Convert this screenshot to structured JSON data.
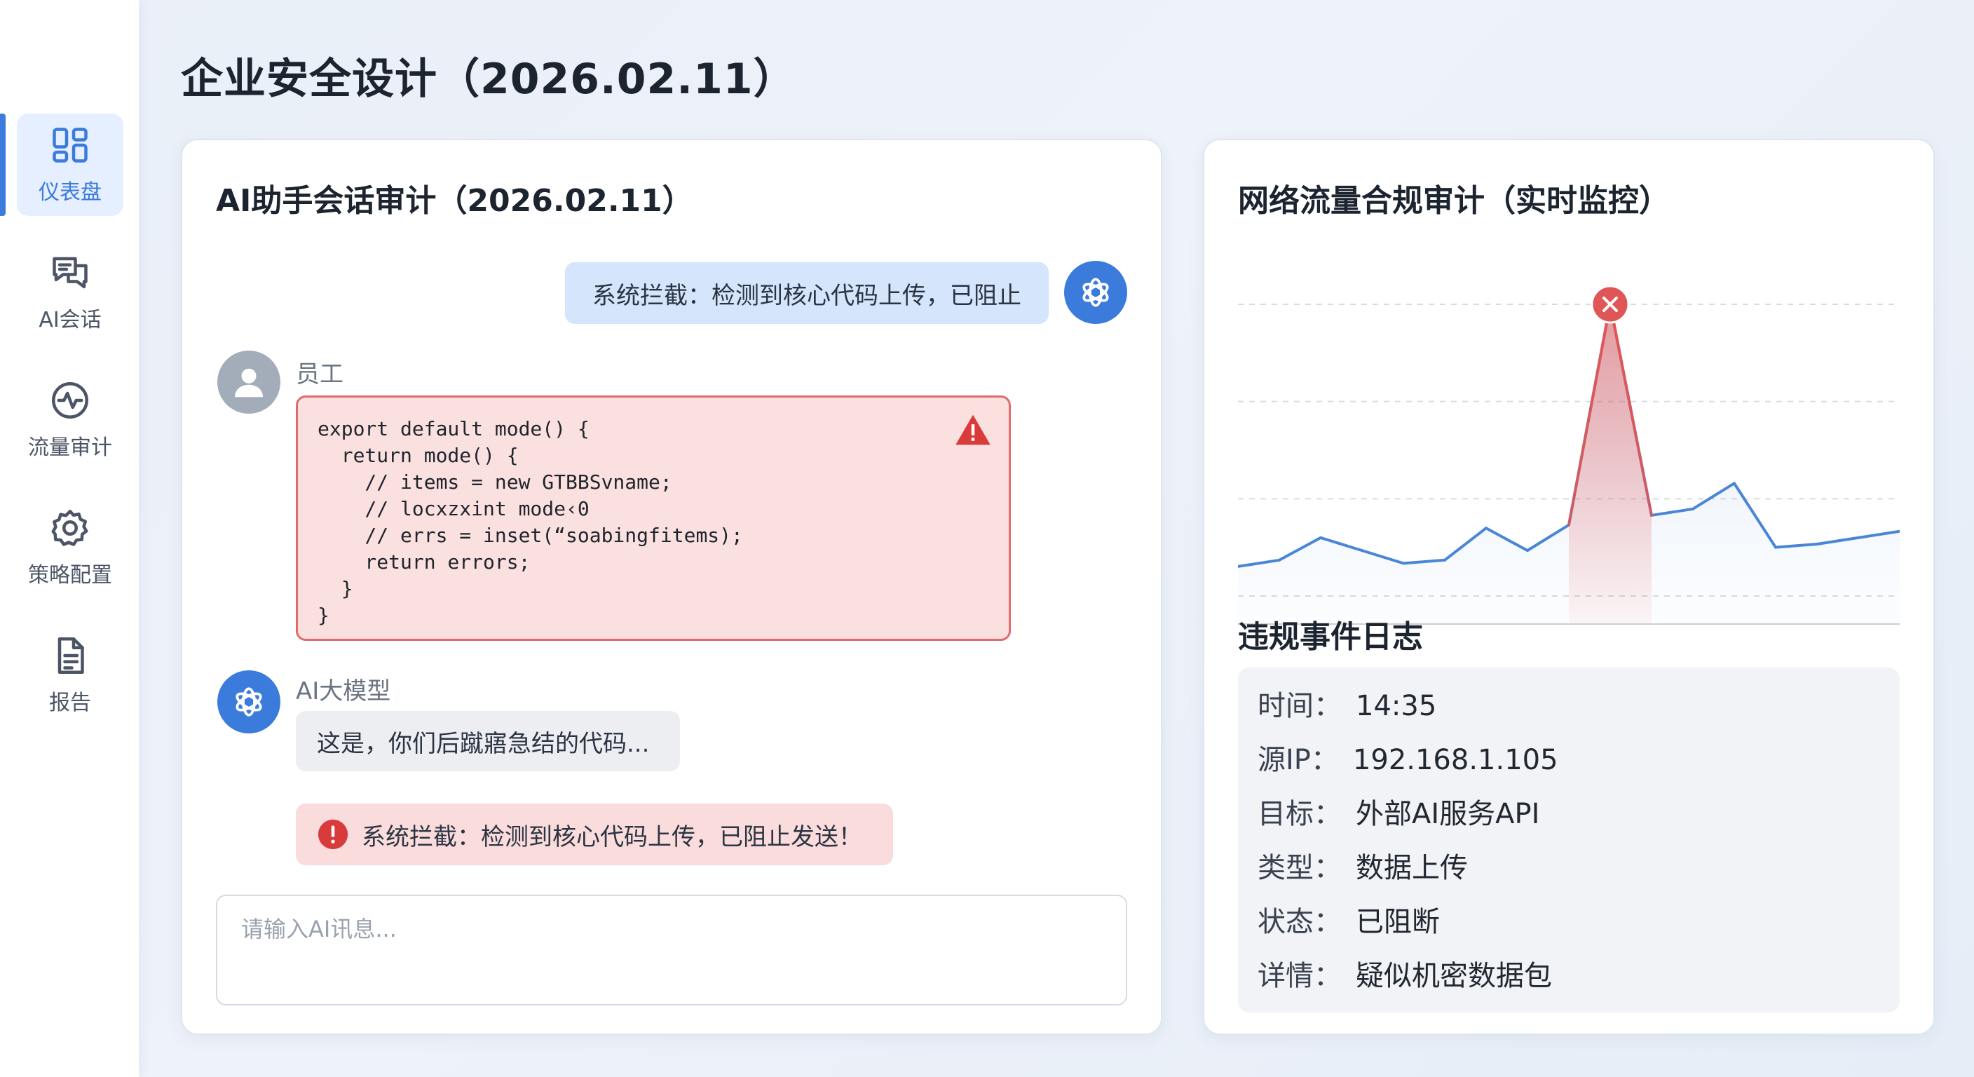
{
  "page": {
    "title": "企业安全设计（2026.02.11）"
  },
  "sidebar": {
    "items": [
      {
        "label": "仪表盘",
        "icon": "dashboard-icon",
        "active": true
      },
      {
        "label": "AI会话",
        "icon": "chat-icon",
        "active": false
      },
      {
        "label": "流量审计",
        "icon": "activity-icon",
        "active": false
      },
      {
        "label": "策略配置",
        "icon": "gear-icon",
        "active": false
      },
      {
        "label": "报告",
        "icon": "document-icon",
        "active": false
      }
    ]
  },
  "chat": {
    "title": "AI助手会话审计（2026.02.11）",
    "system_top": "系统拦截：检测到核心代码上传，已阻止",
    "user_name": "员工",
    "code": "export default mode() {\n  return mode() {\n    // items = new GTBBSvname;\n    // locxzxint mode‹0\n    // errs = inset(“soabingfitems);\n    return errors;\n  }\n}",
    "ai_name": "AI大模型",
    "ai_reply": "这是，你们后蹴寤急结的代码...",
    "alert": "系统拦截：检测到核心代码上传，已阻止发送！",
    "input_placeholder": "请输入AI讯息..."
  },
  "traffic": {
    "title": "网络流量合规审计（实时监控）",
    "chart_data": {
      "type": "line",
      "values": [
        18,
        20,
        27,
        23,
        19,
        20,
        30,
        23,
        31,
        100,
        34,
        36,
        44,
        24,
        25,
        27,
        29
      ],
      "peak_index": 9,
      "line_color": "#4a86d6",
      "peak_color": "#e05656",
      "grid": true
    }
  },
  "log": {
    "title": "违规事件日志",
    "rows": [
      {
        "key": "时间：",
        "value": "14:35"
      },
      {
        "key": "源IP：",
        "value": "192.168.1.105"
      },
      {
        "key": "目标：",
        "value": "外部AI服务API"
      },
      {
        "key": "类型：",
        "value": "数据上传"
      },
      {
        "key": "状态：",
        "value": "已阻断"
      },
      {
        "key": "详情：",
        "value": "疑似机密数据包"
      }
    ]
  }
}
